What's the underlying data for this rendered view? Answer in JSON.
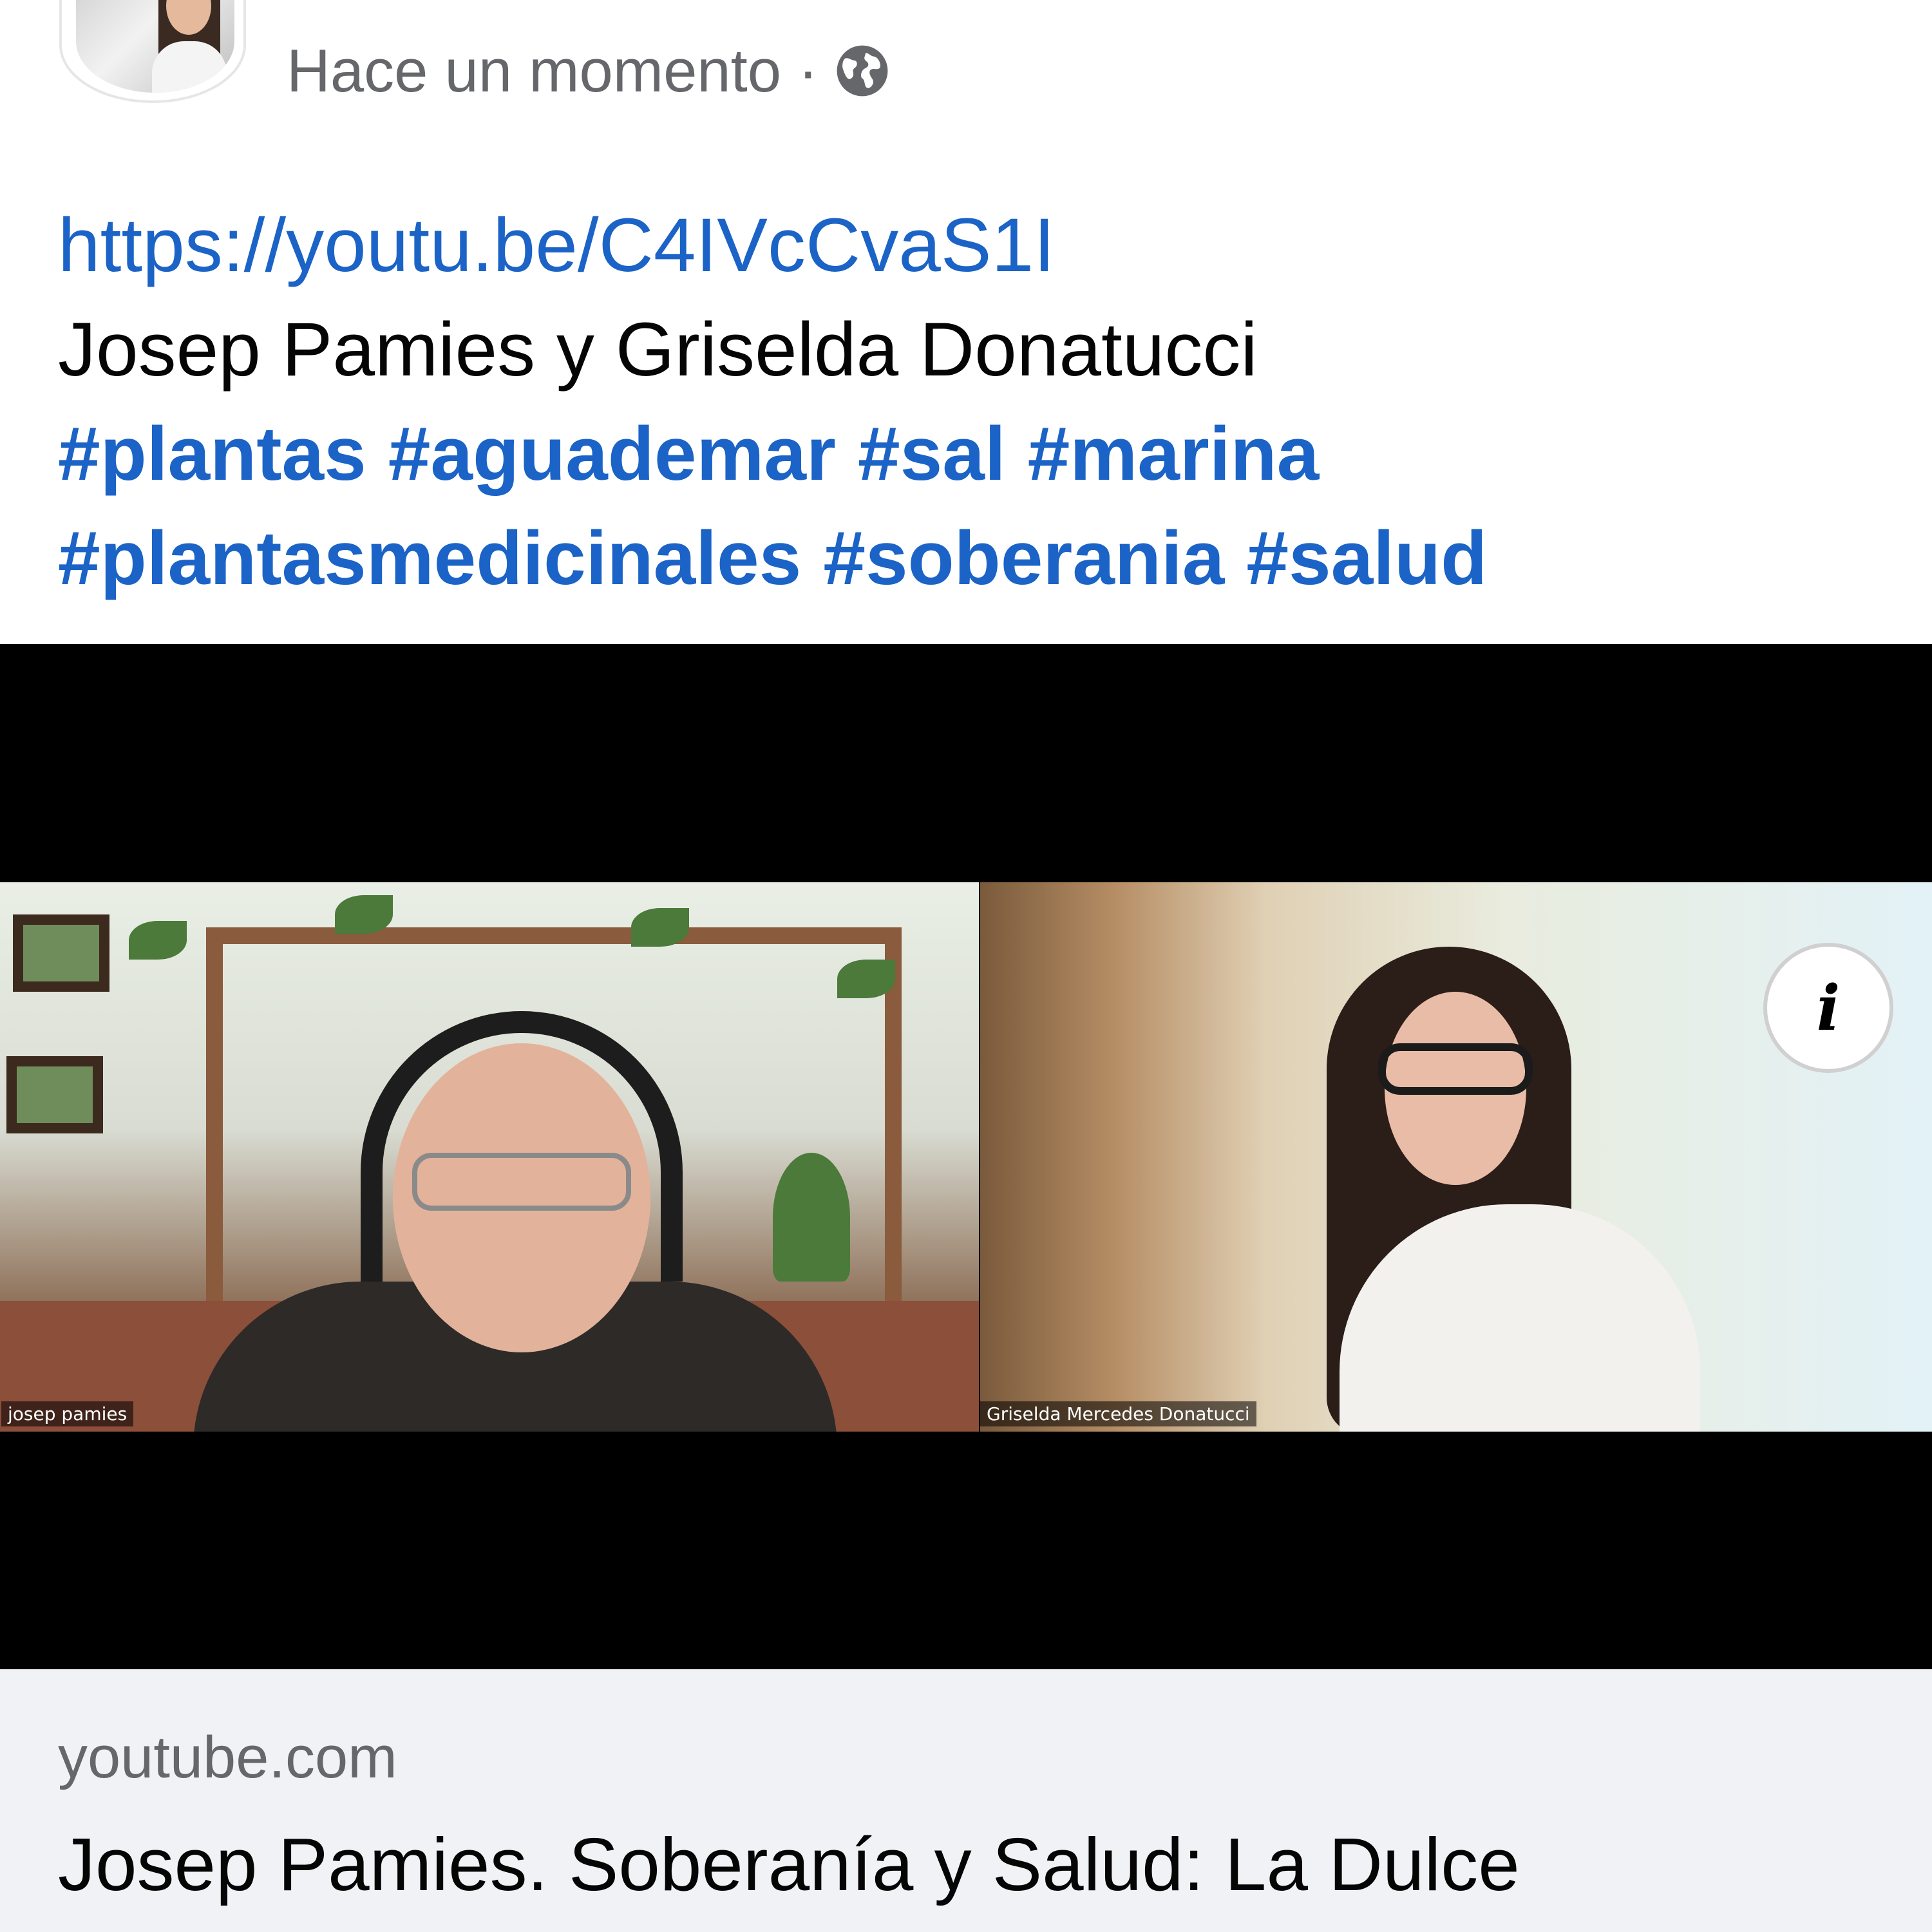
{
  "post": {
    "timestamp": "Hace un momento",
    "separator": "·",
    "privacy_icon": "globe-icon",
    "url": "https://youtu.be/C4IVcCvaS1I",
    "description": "Josep Pamies y Griselda Donatucci",
    "hashtags_line1": [
      "#plantas",
      "#aguademar",
      "#sal",
      "#marina"
    ],
    "hashtags_line2": [
      "#plantasmedicinales",
      "#soberania",
      "#salud"
    ]
  },
  "video": {
    "participants": [
      {
        "name": "josep pamies"
      },
      {
        "name": "Griselda Mercedes Donatucci"
      }
    ],
    "info_icon": "info-icon",
    "info_label": "i"
  },
  "link_card": {
    "domain": "youtube.com",
    "title": "Josep Pamies. Soberanía y Salud: La Dulce Revolución"
  },
  "colors": {
    "link": "#1b63c6",
    "meta_text": "#65676b",
    "body_text": "#050505",
    "card_background": "#f0f2f5"
  }
}
